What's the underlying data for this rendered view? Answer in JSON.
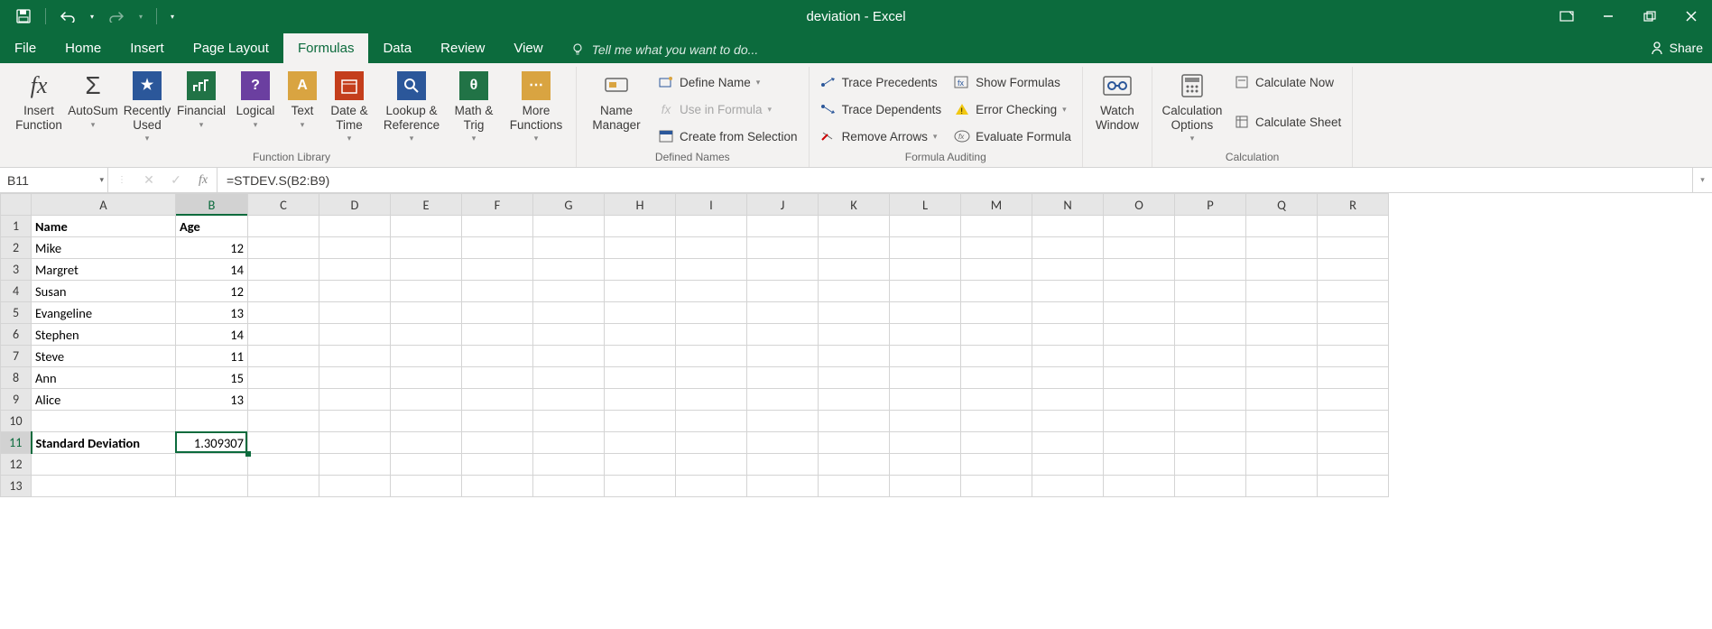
{
  "title": "deviation - Excel",
  "tabs": {
    "file": "File",
    "home": "Home",
    "insert": "Insert",
    "page_layout": "Page Layout",
    "formulas": "Formulas",
    "data": "Data",
    "review": "Review",
    "view": "View"
  },
  "tellme_placeholder": "Tell me what you want to do...",
  "share_label": "Share",
  "ribbon": {
    "insert_function": "Insert\nFunction",
    "autosum": "AutoSum",
    "recently_used": "Recently\nUsed",
    "financial": "Financial",
    "logical": "Logical",
    "text_fn": "Text",
    "date_time": "Date &\nTime",
    "lookup_ref": "Lookup &\nReference",
    "math_trig": "Math &\nTrig",
    "more_fn": "More\nFunctions",
    "group_fnlib": "Function Library",
    "name_manager": "Name\nManager",
    "define_name": "Define Name",
    "use_in_formula": "Use in Formula",
    "create_from_sel": "Create from Selection",
    "group_defnames": "Defined Names",
    "trace_prec": "Trace Precedents",
    "trace_dep": "Trace Dependents",
    "remove_arrows": "Remove Arrows",
    "show_formulas": "Show Formulas",
    "error_check": "Error Checking",
    "eval_formula": "Evaluate Formula",
    "group_auditing": "Formula Auditing",
    "watch_window": "Watch\nWindow",
    "calc_options": "Calculation\nOptions",
    "calc_now": "Calculate Now",
    "calc_sheet": "Calculate Sheet",
    "group_calc": "Calculation"
  },
  "namebox_value": "B11",
  "formula_value": "=STDEV.S(B2:B9)",
  "columns": [
    "A",
    "B",
    "C",
    "D",
    "E",
    "F",
    "G",
    "H",
    "I",
    "J",
    "K",
    "L",
    "M",
    "N",
    "O",
    "P",
    "Q",
    "R"
  ],
  "active_col_index": 1,
  "active_row_index": 10,
  "row_count": 13,
  "cells": {
    "r1": {
      "A": "Name",
      "B": "Age",
      "A_bold": true,
      "B_bold": true
    },
    "r2": {
      "A": "Mike",
      "B": "12"
    },
    "r3": {
      "A": "Margret",
      "B": "14"
    },
    "r4": {
      "A": "Susan",
      "B": "12"
    },
    "r5": {
      "A": "Evangeline",
      "B": "13"
    },
    "r6": {
      "A": "Stephen",
      "B": "14"
    },
    "r7": {
      "A": "Steve",
      "B": "11"
    },
    "r8": {
      "A": "Ann",
      "B": "15"
    },
    "r9": {
      "A": "Alice",
      "B": "13"
    },
    "r10": {
      "A": "",
      "B": ""
    },
    "r11": {
      "A": "Standard Deviation",
      "B": "1.309307",
      "A_bold": true
    },
    "r12": {
      "A": "",
      "B": ""
    },
    "r13": {
      "A": "",
      "B": ""
    }
  }
}
